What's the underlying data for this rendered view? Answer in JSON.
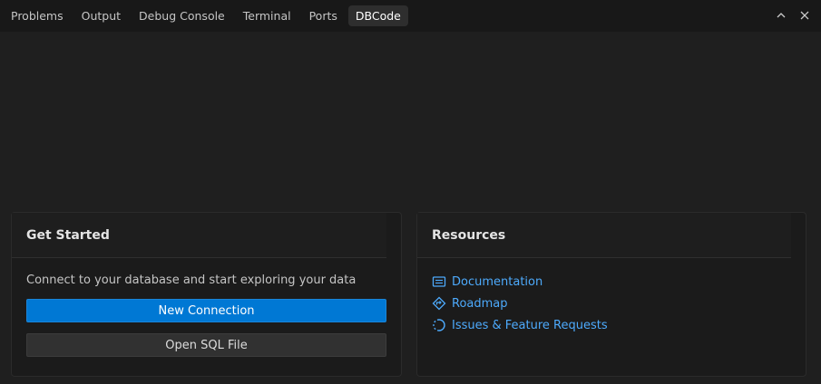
{
  "panel": {
    "tabs": [
      {
        "label": "Problems"
      },
      {
        "label": "Output"
      },
      {
        "label": "Debug Console"
      },
      {
        "label": "Terminal"
      },
      {
        "label": "Ports"
      },
      {
        "label": "DBCode"
      }
    ],
    "active_tab": "DBCode",
    "controls": [
      {
        "icon": "chevron-up-icon"
      },
      {
        "icon": "close-icon"
      }
    ]
  },
  "get_started": {
    "title": "Get Started",
    "description": "Connect to your database and start exploring your data",
    "new_connection_label": "New Connection",
    "open_sql_label": "Open SQL File"
  },
  "resources": {
    "title": "Resources",
    "links": [
      {
        "label": "Documentation",
        "icon": "book-icon"
      },
      {
        "label": "Roadmap",
        "icon": "roadmap-icon"
      },
      {
        "label": "Issues & Feature Requests",
        "icon": "issues-icon"
      }
    ]
  },
  "colors": {
    "accent": "#0078d4",
    "link": "#4daafc",
    "background": "#1f1f1f"
  }
}
